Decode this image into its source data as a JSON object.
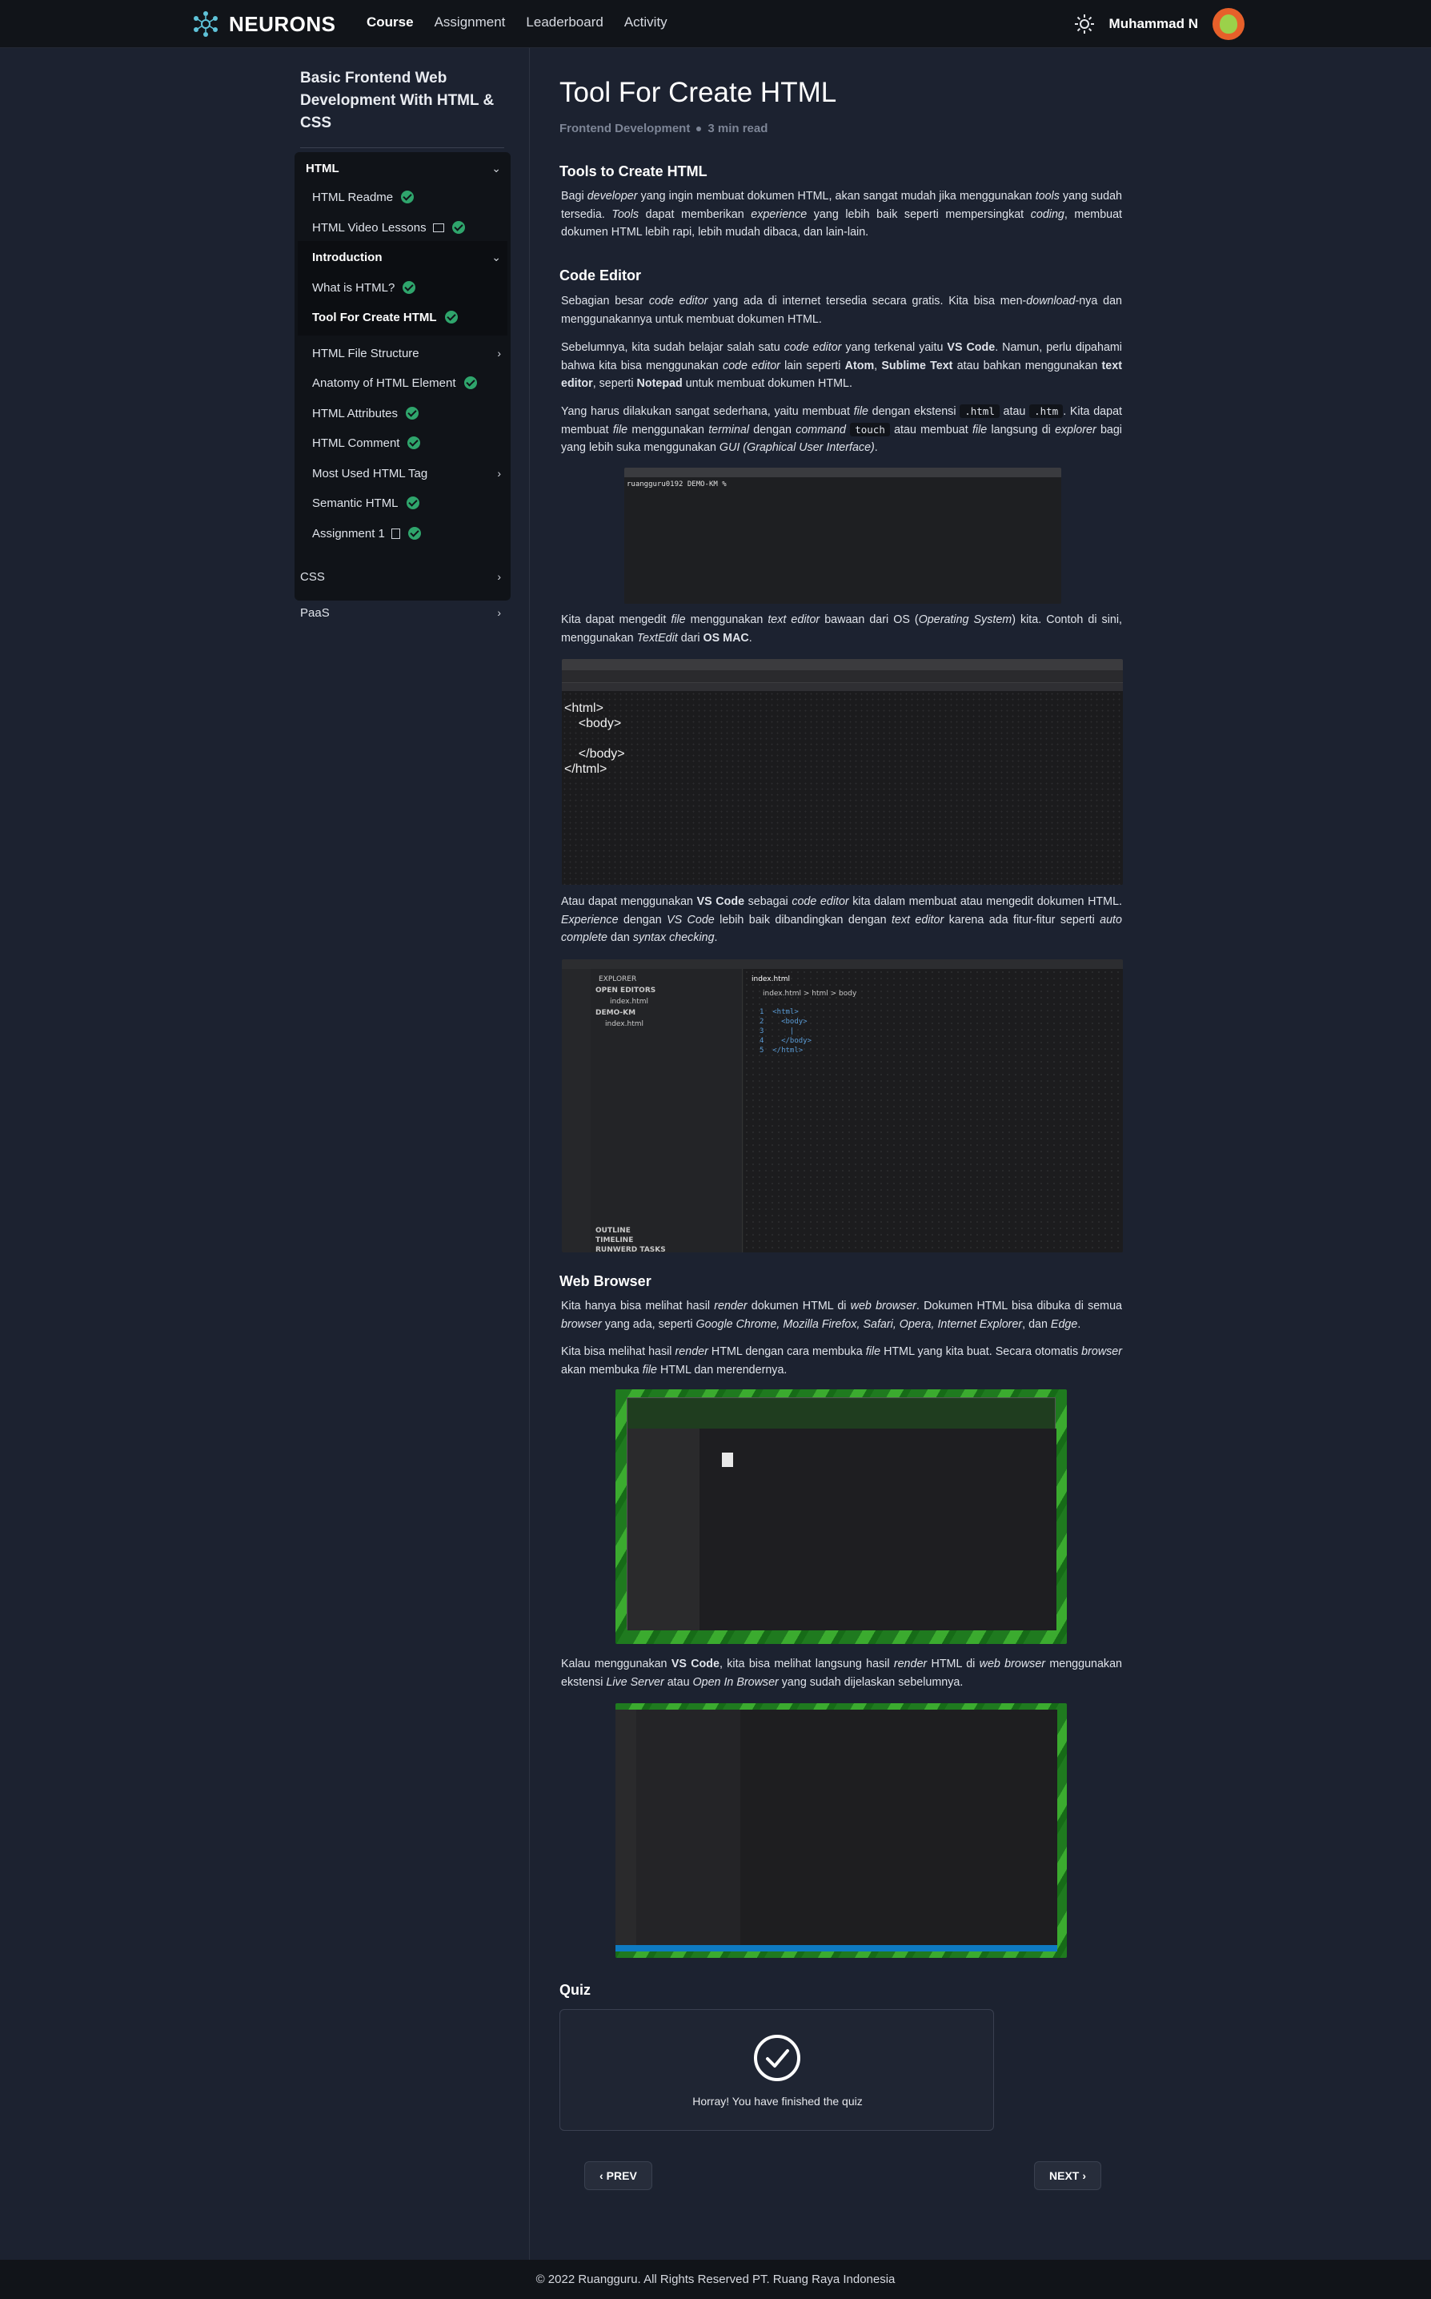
{
  "navbar": {
    "brand": "NEURONS",
    "links": [
      "Course",
      "Assignment",
      "Leaderboard",
      "Activity"
    ],
    "active_link": "Course",
    "theme_icon": "sun-icon",
    "user_name": "Muhammad N"
  },
  "sidebar": {
    "course_title": "Basic Frontend Web Development With HTML & CSS",
    "module_title": "HTML",
    "items": [
      {
        "label": "HTML Readme",
        "completed": true
      },
      {
        "label": "HTML Video Lessons",
        "icon": "video-icon",
        "completed": true
      },
      {
        "label": "Introduction",
        "expanded": true
      },
      {
        "label": "What is HTML?",
        "completed": true
      },
      {
        "label": "Tool For Create HTML",
        "completed": true,
        "active": true
      },
      {
        "label": "HTML File Structure",
        "has_children": true
      },
      {
        "label": "Anatomy of HTML Element",
        "completed": true
      },
      {
        "label": "HTML Attributes",
        "completed": true
      },
      {
        "label": "HTML Comment",
        "completed": true
      },
      {
        "label": "Most Used HTML Tag",
        "has_children": true
      },
      {
        "label": "Semantic HTML",
        "completed": true
      },
      {
        "label": "Assignment 1",
        "icon": "document-icon",
        "completed": true
      }
    ],
    "other_modules": [
      "CSS",
      "PaaS"
    ]
  },
  "article": {
    "title": "Tool For Create HTML",
    "category": "Frontend Development",
    "read_time": "3 min read",
    "section1_title": "Tools to Create HTML",
    "section2_title": "Code Editor",
    "section3_title": "Web Browser",
    "quiz_title": "Quiz",
    "terminal_prompt": "ruangguru0192 DEMO-KM % ",
    "textedit_code": "<html>\n    <body>\n\n    </body>\n</html>",
    "vscode_explorer": "EXPLORER",
    "vscode_open_editors": "OPEN EDITORS",
    "vscode_folder": "DEMO-KM",
    "vscode_file": "index.html",
    "vscode_tab": "index.html",
    "vscode_breadcrumb": "index.html > html > body",
    "vscode_code": "1  <html>\n2    <body>\n3      |\n4    </body>\n5  </html>",
    "vscode_outline": "OUTLINE",
    "vscode_timeline": "TIMELINE",
    "vscode_tasks": "RUNWERD TASKS"
  },
  "quiz": {
    "message": "Horray! You have finished the quiz"
  },
  "pager": {
    "prev": "PREV",
    "next": "NEXT"
  },
  "footer": {
    "text": "© 2022 Ruangguru. All Rights Reserved PT. Ruang Raya Indonesia"
  },
  "colors": {
    "background": "#1c2230",
    "navbar": "#111419",
    "check": "#2fa56c"
  }
}
